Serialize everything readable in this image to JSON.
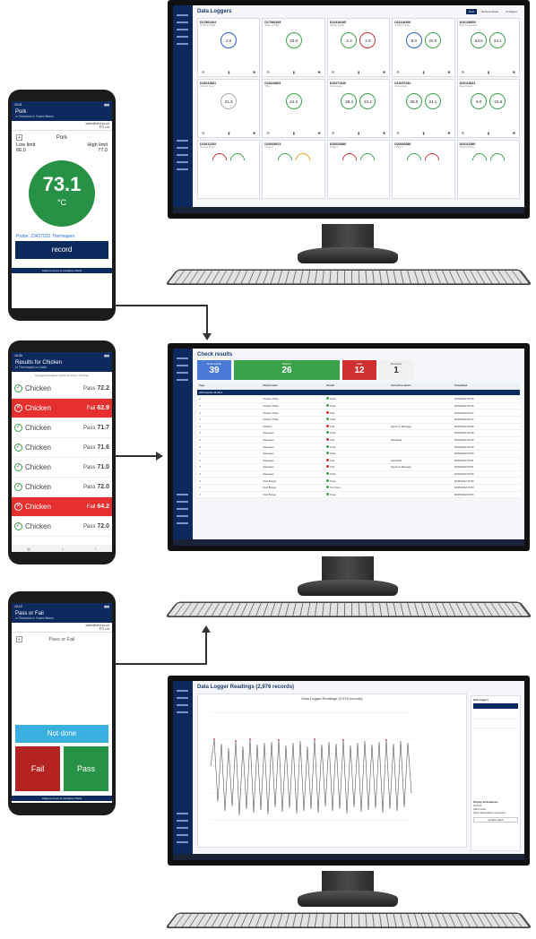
{
  "monitors": {
    "dl": {
      "title": "Data Loggers",
      "header_buttons": [
        "New",
        "Refresh Mode",
        "Configure"
      ],
      "cards": [
        {
          "id": "D17861304",
          "sub": "Hi-Temp Fridge",
          "vals": [
            "2.0"
          ],
          "color": [
            "blue"
          ]
        },
        {
          "id": "D17861108",
          "sub": "Walk In Fridge",
          "vals": [
            "23.8"
          ],
          "color": [
            "green"
          ]
        },
        {
          "id": "D12418165",
          "sub": "Display Fridge",
          "vals": [
            "2.3",
            "2.8"
          ],
          "color": [
            "green",
            "red"
          ]
        },
        {
          "id": "D11416306",
          "sub": "Cooking Fridge",
          "vals": [
            "8.0",
            "20.0"
          ],
          "color": [
            "blue",
            "green"
          ]
        },
        {
          "id": "D10126600",
          "sub": "Back Temperature",
          "vals": [
            "63.5",
            "24.1"
          ],
          "color": [
            "green",
            "green"
          ]
        },
        {
          "id": "D18241801",
          "sub": "Ambient Temp",
          "vals": [
            "21.3"
          ],
          "color": [
            "grey"
          ]
        },
        {
          "id": "D18244601",
          "sub": "Office",
          "vals": [
            "24.2"
          ],
          "color": [
            "green"
          ]
        },
        {
          "id": "D10071040",
          "sub": "Temperature",
          "vals": [
            "38.4",
            "24.2"
          ],
          "color": [
            "green",
            "green"
          ]
        },
        {
          "id": "D14070340",
          "sub": "Temperature",
          "vals": [
            "35.0",
            "24.1"
          ],
          "color": [
            "green",
            "green"
          ]
        },
        {
          "id": "D20116611",
          "sub": "Deep Freeze",
          "vals": [
            "9.0",
            "-15.5"
          ],
          "color": [
            "green",
            "green"
          ]
        },
        {
          "id": "D19411253",
          "sub": "Thermal Probe",
          "vals": [],
          "arcs": [
            "red",
            "green"
          ]
        },
        {
          "id": "D20026574",
          "sub": "Fridge 3",
          "vals": [],
          "arcs": [
            "green",
            "orange"
          ]
        },
        {
          "id": "D20023580",
          "sub": "Fridge 2",
          "vals": [],
          "arcs": [
            "red",
            "green"
          ]
        },
        {
          "id": "D20020086",
          "sub": "Fridge 1",
          "vals": [],
          "arcs": [
            "green",
            "red"
          ]
        },
        {
          "id": "D20111560",
          "sub": "Thermal Probe",
          "vals": [],
          "arcs": [
            "green",
            "green"
          ]
        }
      ]
    },
    "cr": {
      "title": "Check results",
      "summary": [
        {
          "label": "Total results",
          "value": "39",
          "color": "#4b7bd8"
        },
        {
          "label": "Passes",
          "value": "26",
          "color": "#3aa34a"
        },
        {
          "label": "Fails",
          "value": "12",
          "color": "#d03030"
        },
        {
          "label": "Not done",
          "value": "1",
          "color": "#f0f0f0"
        }
      ],
      "columns": [
        "Type",
        "Check name",
        "Result",
        "Corrective action",
        "Completed"
      ],
      "section": "EFS Hamble SLAB-3",
      "rows": [
        [
          "Chicken Tikka",
          "Pass",
          "",
          "18/05/2022 09:46"
        ],
        [
          "Chicken Tikka",
          "Pass",
          "",
          "18/05/2022 09:46"
        ],
        [
          "Chicken Tikka",
          "Fail",
          "",
          "18/05/2022 09:47"
        ],
        [
          "Chicken Tikka",
          "Pass",
          "",
          "18/05/2022 09:47"
        ],
        [
          "Chicken",
          "Fail",
          "Report to Manager",
          "18/05/2022 09:48"
        ],
        [
          "Sausages",
          "Pass",
          "",
          "18/05/2022 09:48"
        ],
        [
          "Sausages",
          "Fail",
          "Discarded",
          "18/05/2022 09:49"
        ],
        [
          "Sausages",
          "Pass",
          "",
          "18/05/2022 09:49"
        ],
        [
          "Sausages",
          "Pass",
          "",
          "18/05/2022 09:50"
        ],
        [
          "Sausages",
          "Fail",
          "Discarded",
          "18/05/2022 09:51"
        ],
        [
          "Sausages",
          "Fail",
          "Report to Manager",
          "18/05/2022 09:51"
        ],
        [
          "Sausages",
          "Pass",
          "",
          "18/05/2022 09:52"
        ],
        [
          "Chef Burger",
          "Pass",
          "",
          "18/05/2022 09:52"
        ],
        [
          "Chef Burger",
          "Not done",
          "",
          "18/05/2022 09:53"
        ],
        [
          "Chef Burger",
          "Pass",
          "",
          "18/05/2022 09:53"
        ]
      ]
    },
    "rd": {
      "title": "Data Logger Readings (2,976 records)",
      "chart_title": "Data Logger Readings (2,976 records)",
      "panel_title": "Data loggers",
      "options": [
        "Display limits/alarms",
        "Normal",
        "Alarm limits",
        "Show alarm/alarm exceeded"
      ],
      "button": "Update graph"
    }
  },
  "phones": {
    "pork": {
      "time": "10:01",
      "title": "Pork",
      "subtitle": "in Chiswick m. Karen Barns",
      "account": "sales@efsl.co.uk",
      "device": "ETI Ltd",
      "product": "Pork",
      "low_limit_label": "Low limit",
      "low_limit": "66.0",
      "high_limit_label": "High limit",
      "high_limit": "77.0",
      "reading": "73.1",
      "unit": "°C",
      "probe_label": "Probe:",
      "probe_value": "23427032 Thermapen",
      "record": "record",
      "footer": "swipe to move to next/prev check"
    },
    "chicken": {
      "time": "10:34",
      "title": "Results for Chicken",
      "subtitle": "in Thermapen on Date",
      "heading": "Average/calculated results for Pass / Chicken",
      "items": [
        {
          "name": "Chicken",
          "result": "Pass",
          "value": "72.2",
          "fail": false
        },
        {
          "name": "Chicken",
          "result": "Fail",
          "value": "62.9",
          "fail": true
        },
        {
          "name": "Chicken",
          "result": "Pass",
          "value": "71.7",
          "fail": false
        },
        {
          "name": "Chicken",
          "result": "Pass",
          "value": "71.6",
          "fail": false
        },
        {
          "name": "Chicken",
          "result": "Pass",
          "value": "71.0",
          "fail": false
        },
        {
          "name": "Chicken",
          "result": "Pass",
          "value": "72.0",
          "fail": false
        },
        {
          "name": "Chicken",
          "result": "Fail",
          "value": "64.2",
          "fail": true
        },
        {
          "name": "Chicken",
          "result": "Pass",
          "value": "72.0",
          "fail": false
        }
      ]
    },
    "passfail": {
      "time": "10:12",
      "title": "Pass or Fail",
      "subtitle": "in Chiswick m. Karen Barns",
      "account": "sales@efsl.co.uk",
      "device": "ETI Ltd",
      "check": "Pass or Fail",
      "not_done": "Not done",
      "fail": "Fail",
      "pass": "Pass",
      "footer": "swipe to move to next/prev check"
    }
  }
}
